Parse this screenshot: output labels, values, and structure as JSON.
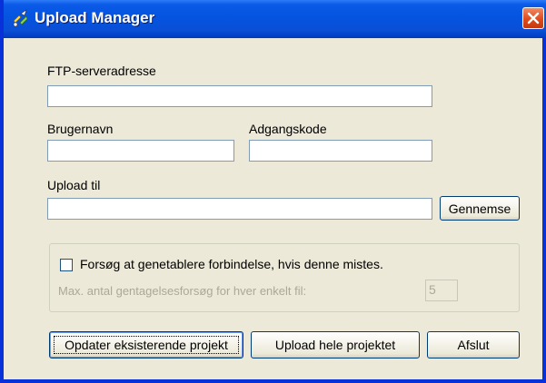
{
  "window": {
    "title": "Upload Manager",
    "icon": "upload-manager-icon"
  },
  "form": {
    "ftp_label": "FTP-serveradresse",
    "ftp_value": "",
    "username_label": "Brugernavn",
    "username_value": "",
    "password_label": "Adgangskode",
    "password_value": "",
    "upload_to_label": "Upload til",
    "upload_to_value": "",
    "browse_label": "Gennemse"
  },
  "options": {
    "reconnect_label": "Forsøg at genetablere forbindelse, hvis denne mistes.",
    "reconnect_checked": false,
    "max_retries_label": "Max. antal gentagelsesforsøg for hver enkelt fil:",
    "max_retries_value": "5"
  },
  "buttons": {
    "update_existing": "Opdater eksisterende projekt",
    "upload_all": "Upload hele projektet",
    "close": "Afslut"
  },
  "colors": {
    "titlebar": "#0554e0",
    "window_bg": "#ece9d8",
    "close_button": "#e04b1b"
  }
}
